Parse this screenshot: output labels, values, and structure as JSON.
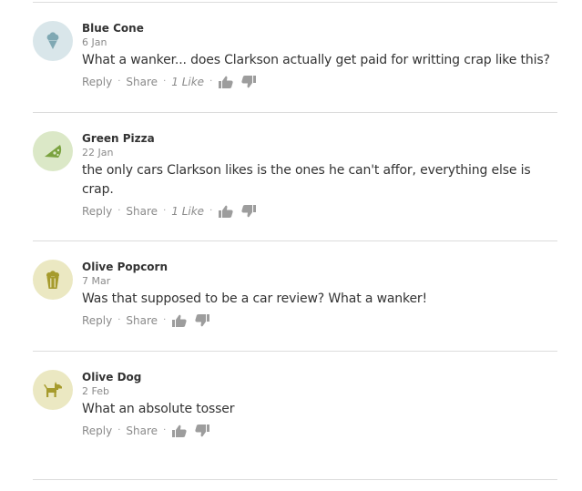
{
  "colors": {
    "avatar_blue": "#d9e6ea",
    "avatar_blue_icon": "#7fa8b3",
    "avatar_green": "#dbe8c7",
    "avatar_green_icon": "#7aa23f",
    "avatar_olive": "#ebe8c2",
    "avatar_olive_icon": "#a69b2c",
    "vote_icon": "#9d9d9d"
  },
  "comments": [
    {
      "author": "Blue Cone",
      "date": "6 Jan",
      "text": "What a wanker... does Clarkson actually get paid for writting crap like this?",
      "reply": "Reply",
      "share": "Share",
      "likes": "1 Like",
      "avatar_icon": "ice-cream-cone-icon"
    },
    {
      "author": "Green Pizza",
      "date": "22 Jan",
      "text": "the only cars Clarkson likes is the ones he can't affor, everything else is crap.",
      "reply": "Reply",
      "share": "Share",
      "likes": "1 Like",
      "avatar_icon": "pizza-slice-icon"
    },
    {
      "author": "Olive Popcorn",
      "date": "7 Mar",
      "text": "Was that supposed to be a car review? What a wanker!",
      "reply": "Reply",
      "share": "Share",
      "avatar_icon": "popcorn-icon"
    },
    {
      "author": "Olive Dog",
      "date": "2 Feb",
      "text": "What an absolute tosser",
      "reply": "Reply",
      "share": "Share",
      "avatar_icon": "dog-icon"
    }
  ]
}
